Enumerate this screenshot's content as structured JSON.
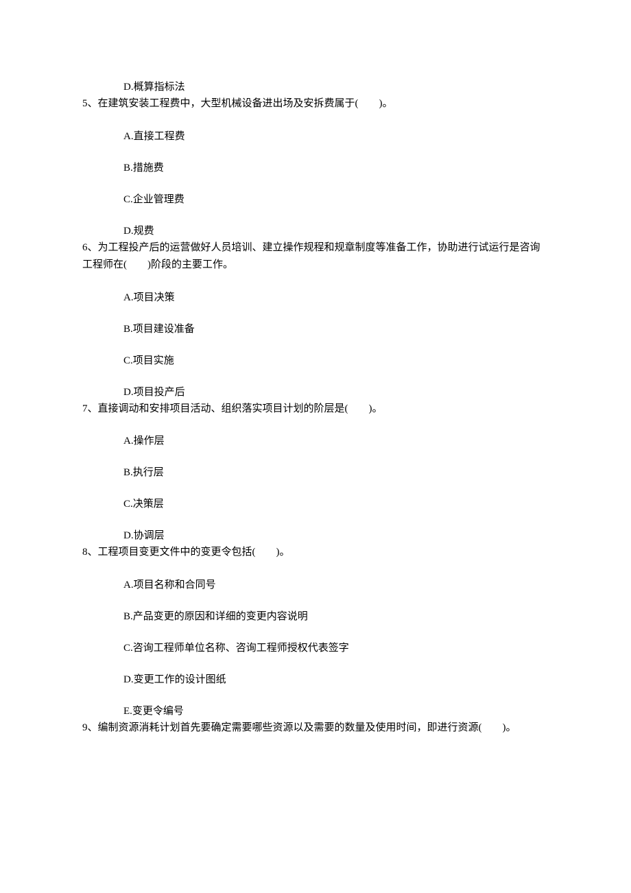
{
  "q4": {
    "optD": "D.概算指标法"
  },
  "q5": {
    "text": "5、在建筑安装工程费中，大型机械设备进出场及安拆费属于(　　)。",
    "optA": "A.直接工程费",
    "optB": "B.措施费",
    "optC": "C.企业管理费",
    "optD": "D.规费"
  },
  "q6": {
    "text": "6、为工程投产后的运营做好人员培训、建立操作规程和规章制度等准备工作，协助进行试运行是咨询工程师在(　　)阶段的主要工作。",
    "optA": "A.项目决策",
    "optB": "B.项目建设准备",
    "optC": "C.项目实施",
    "optD": "D.项目投产后"
  },
  "q7": {
    "text": "7、直接调动和安排项目活动、组织落实项目计划的阶层是(　　)。",
    "optA": "A.操作层",
    "optB": "B.执行层",
    "optC": "C.决策层",
    "optD": "D.协调层"
  },
  "q8": {
    "text": "8、工程项目变更文件中的变更令包括(　　)。",
    "optA": "A.项目名称和合同号",
    "optB": "B.产品变更的原因和详细的变更内容说明",
    "optC": "C.咨询工程师单位名称、咨询工程师授权代表签字",
    "optD": "D.变更工作的设计图纸",
    "optE": "E.变更令编号"
  },
  "q9": {
    "text": "9、编制资源消耗计划首先要确定需要哪些资源以及需要的数量及使用时间，即进行资源(　　)。"
  }
}
